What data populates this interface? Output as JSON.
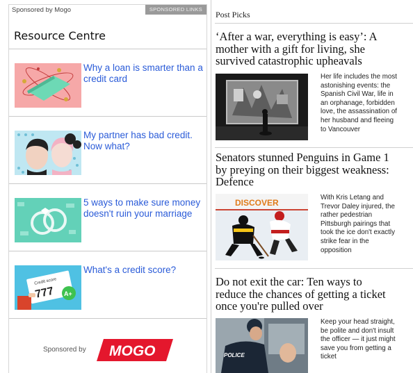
{
  "sponsored_panel": {
    "sponsor_text": "Sponsored by Mogo",
    "sponsored_links_badge": "SPONSORED LINKS",
    "title": "Resource Centre",
    "items": [
      {
        "label": "Why a loan is smarter than a credit card"
      },
      {
        "label": "My partner has bad credit. Now what?"
      },
      {
        "label": "5 ways to make sure money doesn't ruin your marriage"
      },
      {
        "label": "What's a credit score?"
      }
    ],
    "footer_label": "Sponsored by",
    "footer_logo_text": "MOGO",
    "credit_card_text": "Credit score",
    "credit_card_number": "777",
    "credit_card_grade": "A+",
    "colors": {
      "link": "#2a5bd8",
      "brand_red": "#e4172d"
    }
  },
  "post_picks": {
    "header": "Post Picks",
    "articles": [
      {
        "title": "‘After a war, everything is easy’: A mother with a gift for living, she survived catastrophic upheavals",
        "title_lines": [
          "‘After a war, everything is easy’: A",
          "mother with a gift for living, she",
          "survived catastrophic upheavals"
        ],
        "summary": "Her life includes the most astonishing events: the Spanish Civil War, life in an orphanage, forbidden love, the assassination of her husband and fleeing to Vancouver",
        "summary_lines": [
          "Her life includes the most",
          "astonishing events: the",
          "Spanish Civil War, life in",
          "an orphanage, forbidden",
          "love, the assassination of",
          "her husband and fleeing",
          "to Vancouver"
        ]
      },
      {
        "title": "Senators stunned Penguins in Game 1 by preying on their biggest weakness: Defence",
        "title_lines": [
          "Senators stunned Penguins in Game 1",
          "by preying on their biggest weakness:",
          "Defence"
        ],
        "summary": "With Kris Letang and Trevor Daley injured, the rather pedestrian Pittsburgh pairings that took the ice don't exactly strike fear in the opposition",
        "summary_lines": [
          "With Kris Letang and",
          "Trevor Daley injured, the",
          "rather pedestrian",
          "Pittsburgh pairings that",
          "took the ice don't exactly",
          "strike fear in the",
          "opposition"
        ],
        "image_text": "DISCOVER"
      },
      {
        "title": "Do not exit the car: Ten ways to reduce the chances of getting a ticket once you're pulled over",
        "title_lines": [
          "Do not exit the car: Ten ways to",
          "reduce the chances of getting a ticket",
          "once you're pulled over"
        ],
        "summary": "Keep your head straight, be polite and don't insult the officer — it just might save you from getting a ticket",
        "summary_lines": [
          "Keep your head straight,",
          "be polite and don't insult",
          "the officer — it just might",
          "save you from getting a",
          "ticket"
        ],
        "image_text": "POLICE"
      }
    ]
  }
}
